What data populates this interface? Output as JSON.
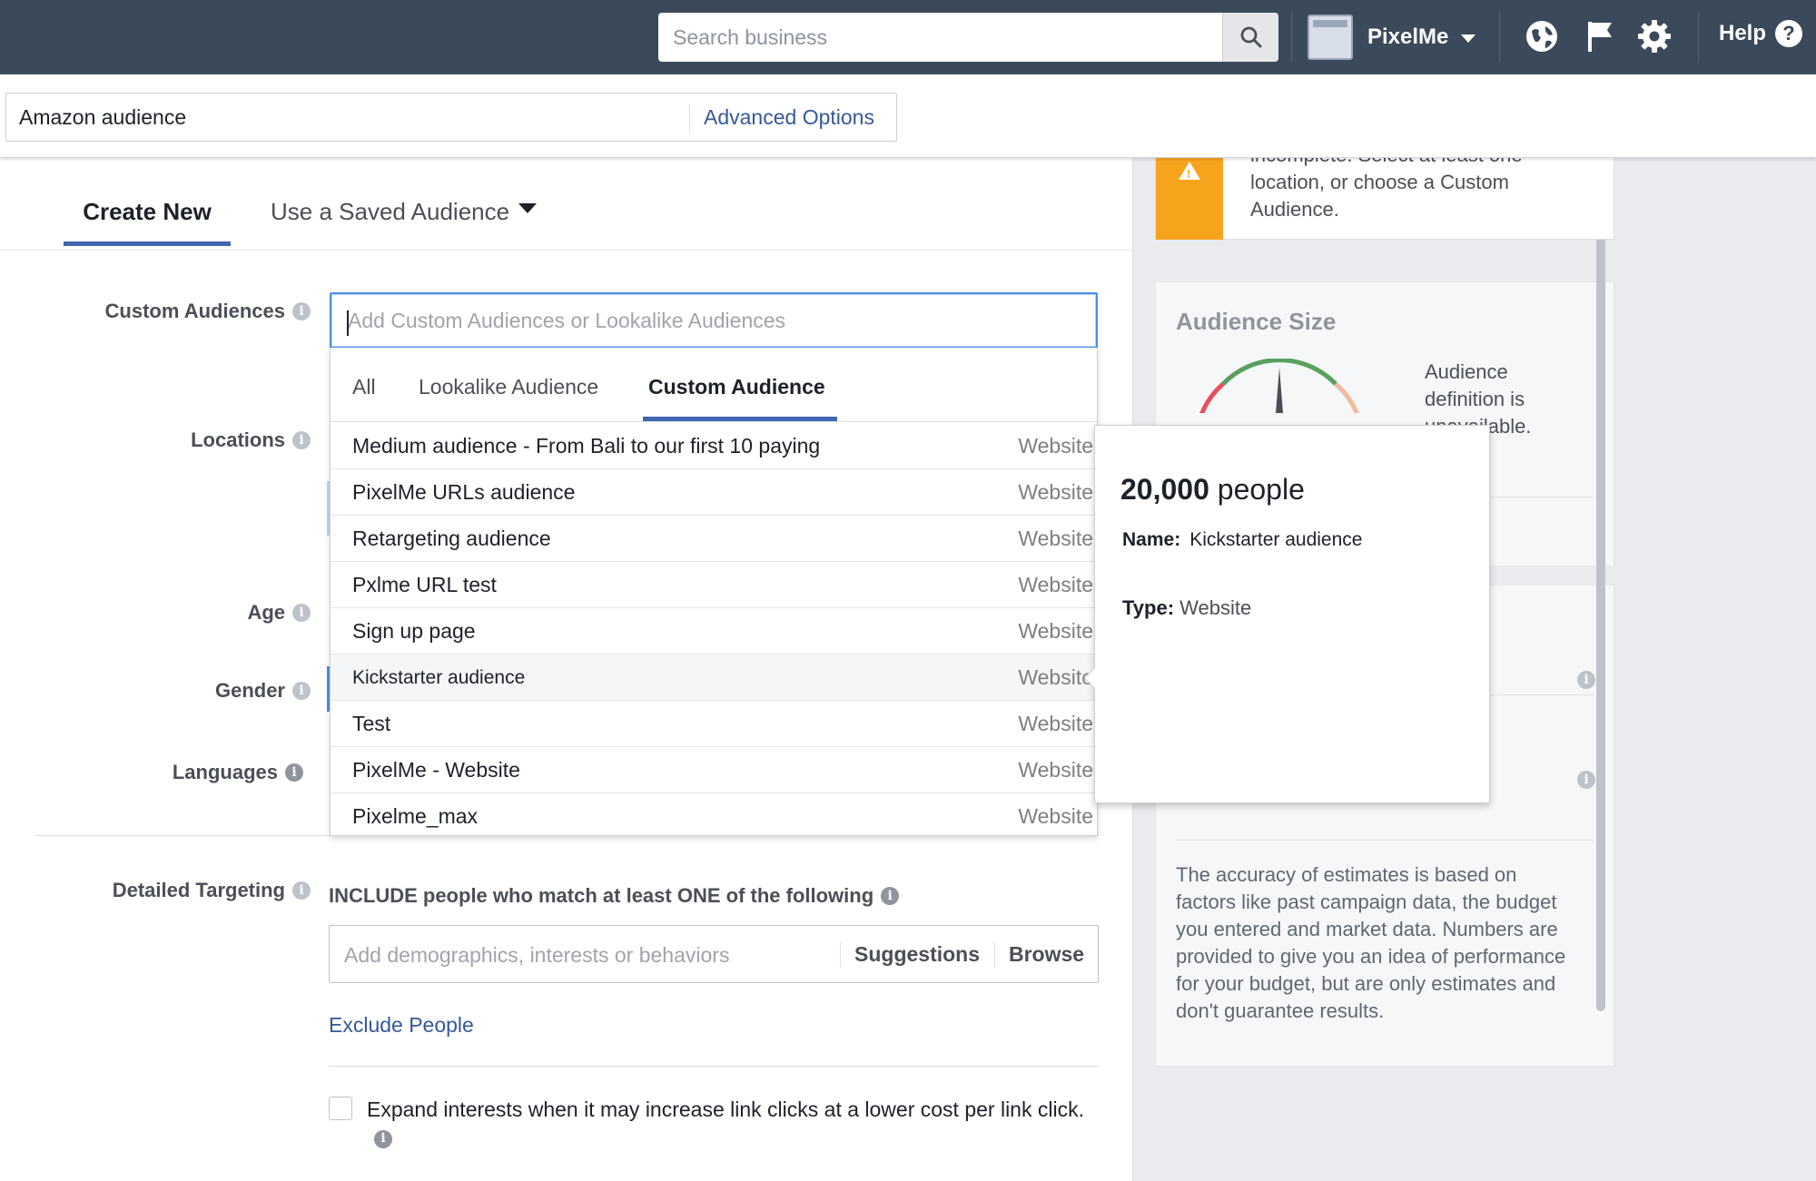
{
  "topbar": {
    "search_placeholder": "Search business",
    "account_name": "PixelMe",
    "help_label": "Help",
    "help_icon": "?"
  },
  "name_bar": {
    "audience_name": "Amazon audience",
    "advanced_options": "Advanced Options"
  },
  "tabs": {
    "create_new": "Create New",
    "use_saved": "Use a Saved Audience"
  },
  "form": {
    "custom_audiences_label": "Custom Audiences",
    "custom_audiences_placeholder": "Add Custom Audiences or Lookalike Audiences",
    "locations_label": "Locations",
    "age_label": "Age",
    "gender_label": "Gender",
    "languages_label": "Languages",
    "detailed_targeting_label": "Detailed Targeting",
    "include_heading": "INCLUDE people who match at least ONE of the following",
    "detailed_placeholder": "Add demographics, interests or behaviors",
    "suggestions_label": "Suggestions",
    "browse_label": "Browse",
    "exclude_people": "Exclude People",
    "expand_interests": "Expand interests when it may increase link clicks at a lower cost per link click."
  },
  "dropdown": {
    "tabs": [
      "All",
      "Lookalike Audience",
      "Custom Audience"
    ],
    "active_tab": "Custom Audience",
    "rows": [
      {
        "name": "Medium audience - From Bali to our first 10 paying",
        "type": "Website"
      },
      {
        "name": "PixelMe URLs audience",
        "type": "Website"
      },
      {
        "name": "Retargeting audience",
        "type": "Website"
      },
      {
        "name": "Pxlme URL test",
        "type": "Website"
      },
      {
        "name": "Sign up page",
        "type": "Website"
      },
      {
        "name": "Kickstarter audience",
        "type": "Website"
      },
      {
        "name": "Test",
        "type": "Website"
      },
      {
        "name": "PixelMe - Website",
        "type": "Website"
      },
      {
        "name": "Pixelme_max",
        "type": "Website"
      }
    ],
    "highlighted_index": 5
  },
  "hover_card": {
    "count": "20,000",
    "count_unit": "people",
    "name_label": "Name:",
    "name_value": "Kickstarter audience",
    "type_label": "Type:",
    "type_value": "Website"
  },
  "warning": {
    "text": "incomplete. Select at least one location, or choose a Custom Audience.",
    "icon": "warning-icon"
  },
  "audience_size": {
    "title": "Audience Size",
    "description": "Audience definition is unavailable.",
    "accuracy_note": "The accuracy of estimates is based on factors like past campaign data, the budget you entered and market data. Numbers are provided to give you an idea of performance for your budget, but are only estimates and don't guarantee results."
  },
  "colors": {
    "topbar": "#3b4a5a",
    "accent": "#4267b2",
    "link": "#365899",
    "warning": "#f7a41d"
  }
}
